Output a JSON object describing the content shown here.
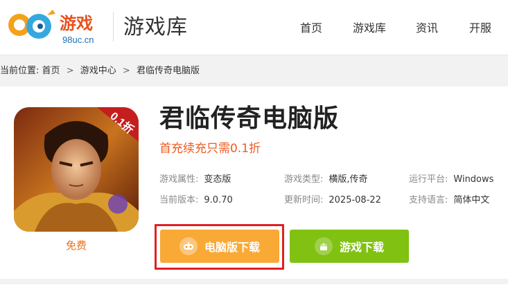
{
  "header": {
    "logo": {
      "brand_text": "游戏",
      "sub_text": "98uc.cn",
      "digits": "98"
    },
    "section_title": "游戏库",
    "nav": [
      {
        "label": "首页"
      },
      {
        "label": "游戏库"
      },
      {
        "label": "资讯"
      },
      {
        "label": "开服"
      }
    ]
  },
  "breadcrumb": {
    "prefix": "当前位置:",
    "items": [
      "首页",
      "游戏中心",
      "君临传奇电脑版"
    ],
    "separator": ">"
  },
  "game": {
    "badge": "0.1折",
    "price_label": "免费",
    "title": "君临传奇电脑版",
    "promo": "首充续充只需0.1折",
    "attributes": [
      {
        "key": "游戏属性:",
        "value": "变态版"
      },
      {
        "key": "游戏类型:",
        "value": "横版,传奇"
      },
      {
        "key": "运行平台:",
        "value": "Windows"
      },
      {
        "key": "当前版本:",
        "value": "9.0.70"
      },
      {
        "key": "更新时间:",
        "value": "2025-08-22"
      },
      {
        "key": "支持语言:",
        "value": "简体中文"
      }
    ]
  },
  "buttons": {
    "pc_download": "电脑版下载",
    "game_download": "游戏下载"
  },
  "colors": {
    "accent_orange": "#f8a936",
    "accent_green": "#80c112",
    "promo_red": "#f05a22",
    "highlight_red": "#e02020"
  }
}
